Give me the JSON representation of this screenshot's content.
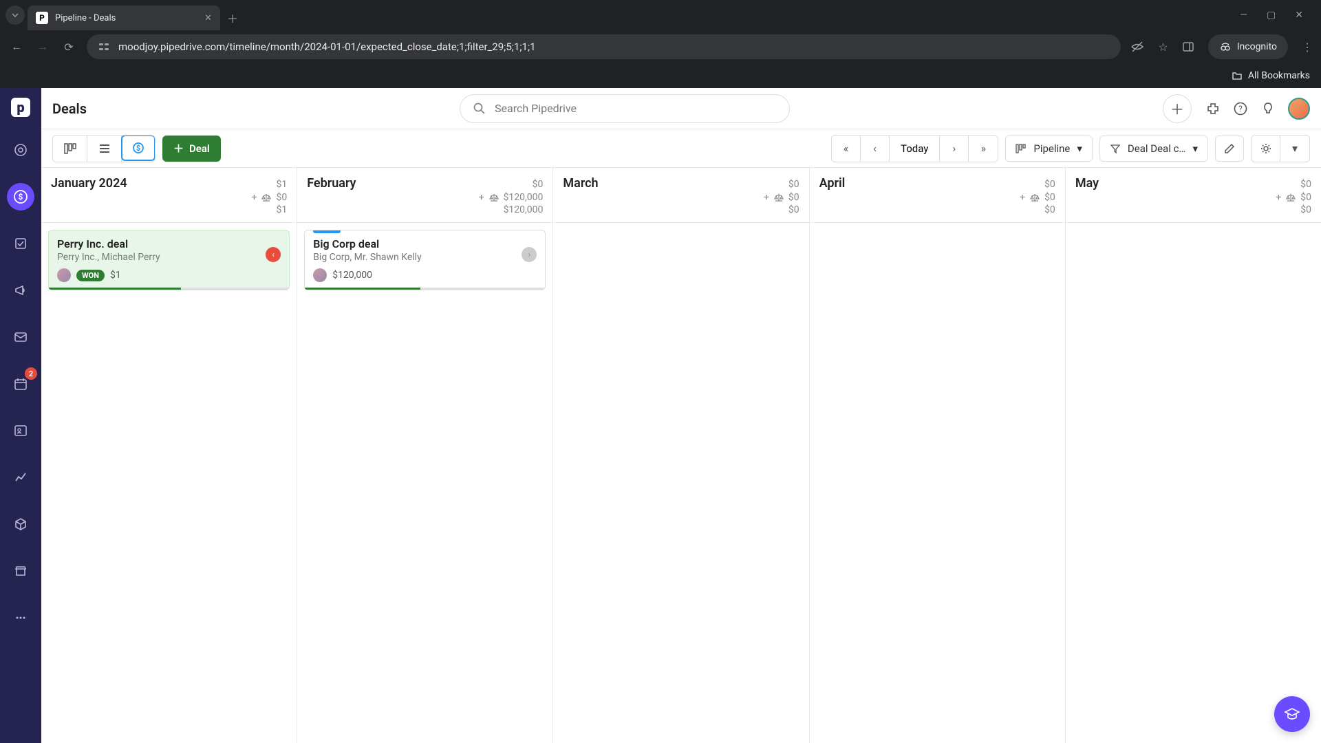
{
  "browser": {
    "tab_title": "Pipeline - Deals",
    "url": "moodjoy.pipedrive.com/timeline/month/2024-01-01/expected_close_date;1;filter_29;5;1;1;1",
    "incognito_label": "Incognito",
    "bookmarks_label": "All Bookmarks"
  },
  "header": {
    "title": "Deals",
    "search_placeholder": "Search Pipedrive"
  },
  "toolbar": {
    "deal_label": "Deal",
    "today_label": "Today",
    "pipeline_label": "Pipeline",
    "filter_label": "Deal Deal c…"
  },
  "sidebar": {
    "badge_count": "2"
  },
  "months": [
    {
      "name": "January 2024",
      "top_amount": "$1",
      "weighted": "$0",
      "bottom": "$1",
      "deals": [
        {
          "title": "Perry Inc. deal",
          "subtitle": "Perry Inc., Michael Perry",
          "value": "$1",
          "won": true,
          "won_label": "WON",
          "progress": 55,
          "status": "red",
          "stripe": ""
        }
      ]
    },
    {
      "name": "February",
      "top_amount": "$0",
      "weighted": "$120,000",
      "bottom": "$120,000",
      "deals": [
        {
          "title": "Big Corp deal",
          "subtitle": "Big Corp, Mr. Shawn Kelly",
          "value": "$120,000",
          "won": false,
          "progress": 48,
          "status": "gray",
          "stripe": "#2196f3"
        }
      ]
    },
    {
      "name": "March",
      "top_amount": "$0",
      "weighted": "$0",
      "bottom": "$0",
      "deals": []
    },
    {
      "name": "April",
      "top_amount": "$0",
      "weighted": "$0",
      "bottom": "$0",
      "deals": []
    },
    {
      "name": "May",
      "top_amount": "$0",
      "weighted": "$0",
      "bottom": "$0",
      "deals": []
    }
  ]
}
